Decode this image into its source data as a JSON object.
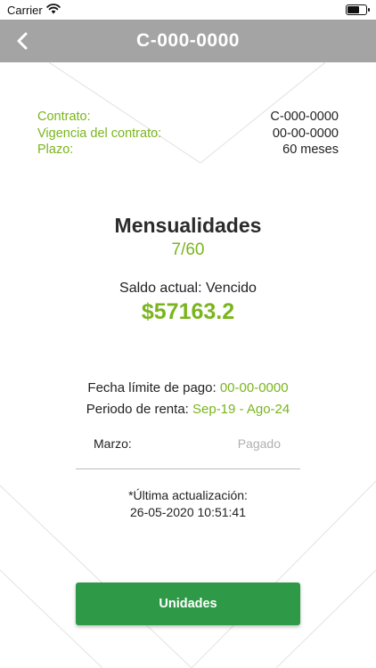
{
  "status_bar": {
    "carrier": "Carrier",
    "time": ""
  },
  "nav": {
    "title": "C-000-0000",
    "back_icon": "chevron-left-icon"
  },
  "contract_info": [
    {
      "label": "Contrato:",
      "value": "C-000-0000"
    },
    {
      "label": "Vigencia del contrato:",
      "value": "00-00-0000"
    },
    {
      "label": "Plazo:",
      "value": "60 meses"
    }
  ],
  "mensualidades": {
    "title": "Mensualidades",
    "count": "7/60"
  },
  "saldo": {
    "label": "Saldo actual: Vencido",
    "amount": "$57163.2"
  },
  "payment": {
    "fecha_label": "Fecha límite de pago:",
    "fecha_value": "00-00-0000",
    "periodo_label": "Periodo de renta:",
    "periodo_value": "Sep-19 - Ago-24"
  },
  "months": [
    {
      "name": "Marzo:",
      "status": "Pagado"
    }
  ],
  "update": {
    "label": "*Última actualización:",
    "date": "26-05-2020 10:51:41"
  },
  "buttons": {
    "unidades": "Unidades"
  },
  "colors": {
    "accent_green": "#7ab51d",
    "button_green": "#2e9a47",
    "navbar_gray": "#a4a4a4"
  }
}
